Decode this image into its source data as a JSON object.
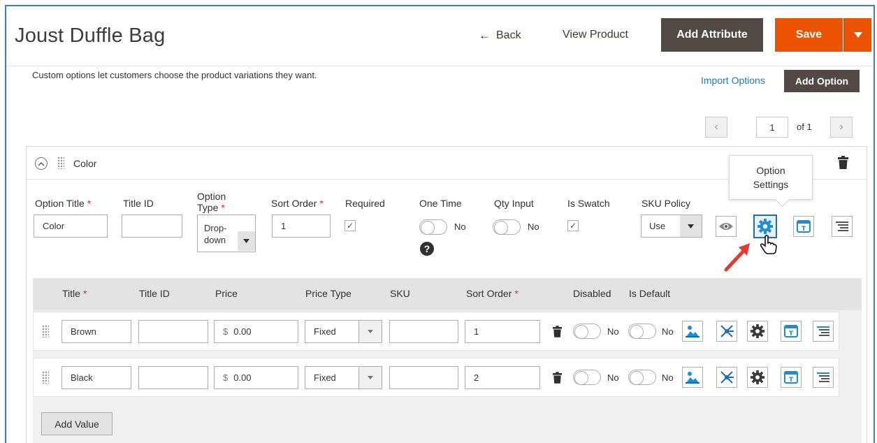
{
  "header": {
    "title": "Joust Duffle Bag",
    "back_label": "Back",
    "view_product_label": "View Product",
    "add_attribute_label": "Add Attribute",
    "save_label": "Save"
  },
  "custom_options": {
    "note": "Custom options let customers choose the product variations they want.",
    "import_label": "Import Options",
    "add_option_label": "Add Option"
  },
  "pager": {
    "current": "1",
    "of_label": "of 1"
  },
  "option": {
    "header_title": "Color",
    "labels": {
      "option_title": "Option Title",
      "title_id": "Title ID",
      "option_type_line1": "Option",
      "option_type_line2": "Type",
      "sort_order": "Sort Order",
      "required": "Required",
      "one_time": "One Time",
      "qty_input": "Qty Input",
      "is_swatch": "Is Swatch",
      "sku_policy": "SKU Policy"
    },
    "values": {
      "option_title": "Color",
      "title_id": "",
      "option_type_line1": "Drop-",
      "option_type_line2": "down",
      "sort_order": "1",
      "one_time_state": "No",
      "qty_input_state": "No",
      "sku_policy": "Use"
    },
    "tooltip_line1": "Option",
    "tooltip_line2": "Settings"
  },
  "values_table": {
    "headers": {
      "title": "Title",
      "title_id": "Title ID",
      "price": "Price",
      "price_type": "Price Type",
      "sku": "SKU",
      "sort_order": "Sort Order",
      "disabled": "Disabled",
      "is_default": "Is Default"
    },
    "rows": [
      {
        "title": "Brown",
        "title_id": "",
        "currency": "$",
        "price": "0.00",
        "price_type": "Fixed",
        "sku": "",
        "sort_order": "1",
        "disabled": "No",
        "is_default": "No"
      },
      {
        "title": "Black",
        "title_id": "",
        "currency": "$",
        "price": "0.00",
        "price_type": "Fixed",
        "sku": "",
        "sort_order": "2",
        "disabled": "No",
        "is_default": "No"
      }
    ],
    "add_value_label": "Add Value"
  },
  "colors": {
    "accent_orange": "#eb5202",
    "dark_button": "#514943",
    "link_blue": "#1979c3",
    "icon_blue": "#1a8fd8",
    "required_red": "#e22626"
  }
}
